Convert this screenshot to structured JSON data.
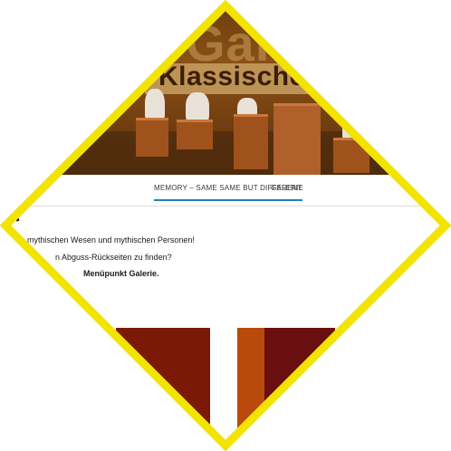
{
  "header": {
    "site_title_partial": "Gal",
    "subtitle_partial": "Klassischer B"
  },
  "nav": {
    "items": [
      {
        "label": "MEMORY – SAME SAME BUT DIFFERENT",
        "active": true
      },
      {
        "label": "GALERIE",
        "active": false
      }
    ]
  },
  "content": {
    "bullet": "•",
    "line1": "mythischen Wesen und mythischen Personen!",
    "line2": "n Abguss-Rückseiten zu finden?",
    "line3": "Menüpunkt Galerie."
  },
  "colors": {
    "frame": "#f2e400",
    "accent": "#1e7fc0",
    "thumb1": "#7a1a06",
    "thumb2": "#b84a0c",
    "thumb3": "#6a0f10"
  }
}
